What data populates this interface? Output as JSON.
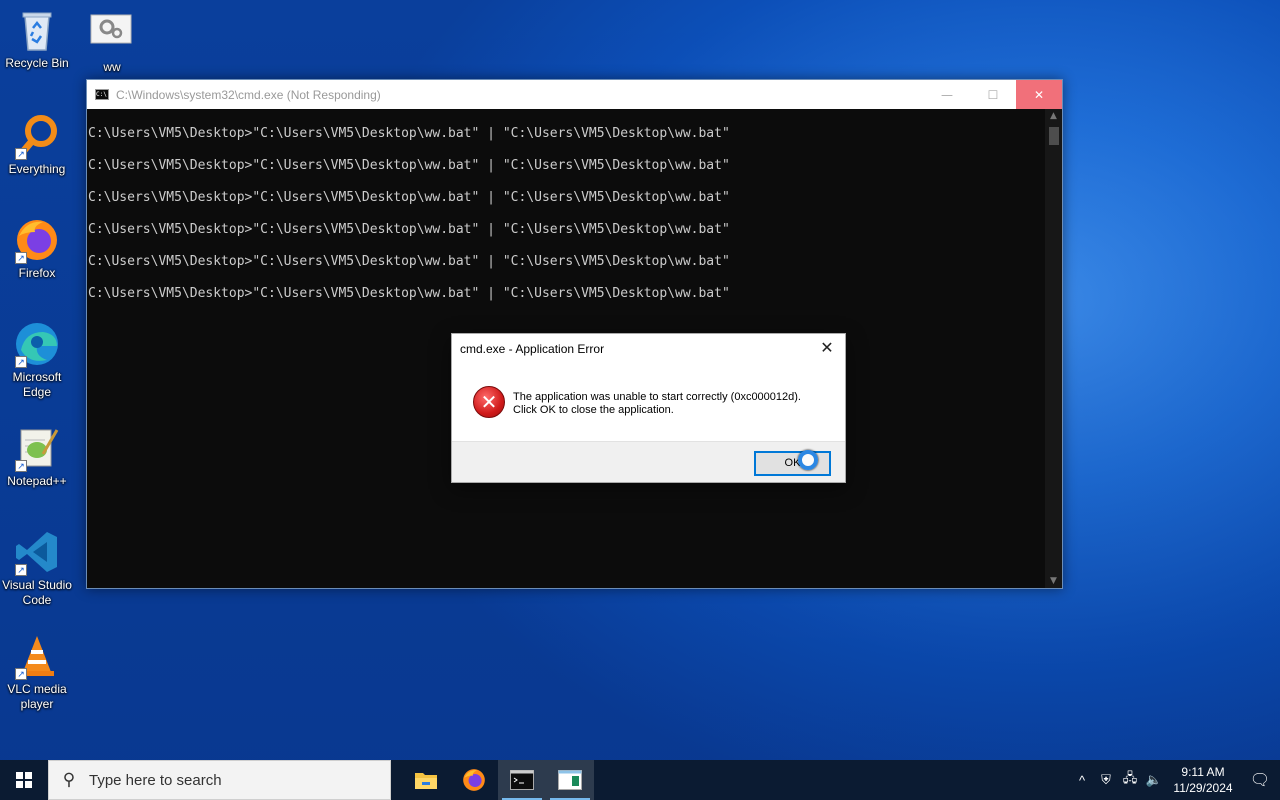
{
  "desktop": {
    "icons": [
      {
        "label": "Recycle Bin"
      },
      {
        "label": "ww"
      },
      {
        "label": "Everything"
      },
      {
        "label": "Firefox"
      },
      {
        "label": "Microsoft Edge"
      },
      {
        "label": "Notepad++"
      },
      {
        "label": "Visual Studio Code"
      },
      {
        "label": "VLC media player"
      }
    ]
  },
  "cmd_window": {
    "title": "C:\\Windows\\system32\\cmd.exe (Not Responding)",
    "lines": [
      "C:\\Users\\VM5\\Desktop>\"C:\\Users\\VM5\\Desktop\\ww.bat\" | \"C:\\Users\\VM5\\Desktop\\ww.bat\"",
      "C:\\Users\\VM5\\Desktop>\"C:\\Users\\VM5\\Desktop\\ww.bat\" | \"C:\\Users\\VM5\\Desktop\\ww.bat\"",
      "C:\\Users\\VM5\\Desktop>\"C:\\Users\\VM5\\Desktop\\ww.bat\" | \"C:\\Users\\VM5\\Desktop\\ww.bat\"",
      "C:\\Users\\VM5\\Desktop>\"C:\\Users\\VM5\\Desktop\\ww.bat\" | \"C:\\Users\\VM5\\Desktop\\ww.bat\"",
      "C:\\Users\\VM5\\Desktop>\"C:\\Users\\VM5\\Desktop\\ww.bat\" | \"C:\\Users\\VM5\\Desktop\\ww.bat\"",
      "C:\\Users\\VM5\\Desktop>\"C:\\Users\\VM5\\Desktop\\ww.bat\" | \"C:\\Users\\VM5\\Desktop\\ww.bat\""
    ]
  },
  "dialog": {
    "title": "cmd.exe - Application Error",
    "message_line1": "The application was unable to start correctly (0xc000012d).",
    "message_line2": "Click OK to close the application.",
    "ok_label": "OK"
  },
  "taskbar": {
    "search_placeholder": "Type here to search",
    "time": "9:11 AM",
    "date": "11/29/2024",
    "apps": [
      "file-explorer-icon",
      "firefox-icon",
      "cmd-icon",
      "notepad-window-icon"
    ]
  }
}
